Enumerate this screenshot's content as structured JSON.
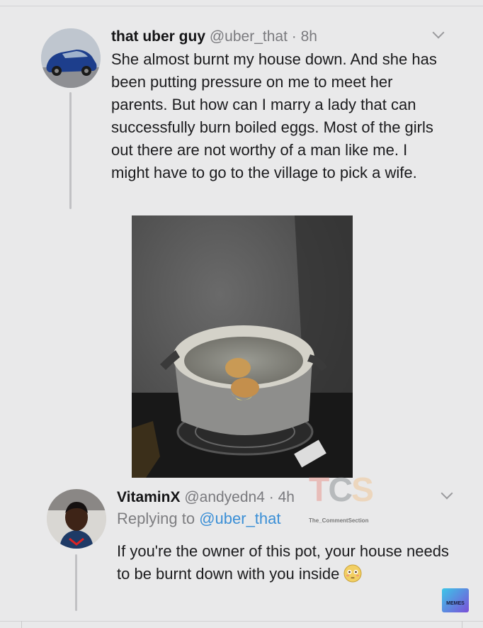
{
  "tweet": {
    "author_name": "that uber guy",
    "author_handle": "@uber_that",
    "separator": "·",
    "time": "8h",
    "text": "She almost burnt my house down. And she has been putting pressure on me to meet her parents. But how can I marry a lady that can successfully burn boiled eggs. Most of the girls out there are not worthy of a man like me. I might have to go to the village to pick a wife.",
    "avatar_icon": "car-photo-avatar",
    "photo": "burnt-pot-with-eggs-photo"
  },
  "reply": {
    "author_name": "VitaminX",
    "author_handle": "@andyedn4",
    "separator": "·",
    "time": "4h",
    "replying_prefix": "Replying to",
    "replying_to": "@uber_that",
    "text": "If you're the owner of this pot, your house needs to be burnt down with you inside",
    "emoji": "flushed-face-emoji",
    "avatar_icon": "person-photo-avatar"
  },
  "watermark": {
    "t": "T",
    "c": "C",
    "s": "S",
    "caption": "The_CommentSection"
  },
  "badge": {
    "label": "MEMES"
  },
  "colors": {
    "background": "#e9e9ea",
    "mention": "#3b8fd6",
    "meta": "#7a7a7e"
  }
}
